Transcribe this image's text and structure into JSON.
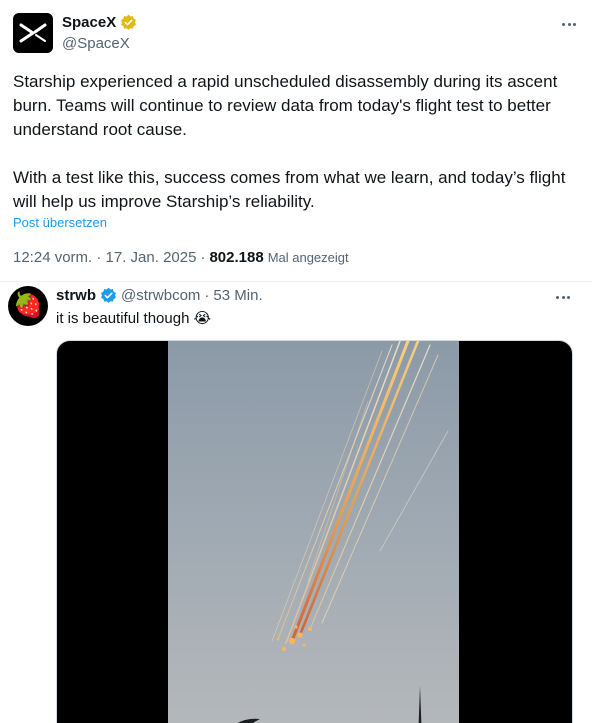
{
  "tweet": {
    "author": {
      "name": "SpaceX",
      "handle": "@SpaceX",
      "verified_badge_color": "#e2b719"
    },
    "paragraphs": [
      "Starship experienced a rapid unscheduled disassembly during its ascent burn. Teams will continue to review data from today's flight test to better understand root cause.",
      "With a test like this, success comes from what we learn, and today’s flight will help us improve Starship’s reliability."
    ],
    "translate_label": "Post übersetzen",
    "timestamp": "12:24 vorm. · 17. Jan. 2025",
    "separator": "·",
    "views_count": "802.188",
    "views_label": "Mal angezeigt",
    "more_icon": "more-horizontal-icon"
  },
  "reply": {
    "author": {
      "name": "strwb",
      "handle": "@strwbcom",
      "verified_badge_color": "#1d9bf0"
    },
    "separator": "·",
    "time": "53 Min.",
    "text": "it is beautiful though",
    "emoji": "😭",
    "avatar_emoji": "🍓",
    "more_icon": "more-horizontal-icon",
    "media_icon": "video-thumbnail"
  },
  "colors": {
    "link": "#1d9bf0",
    "secondary_text": "#536471",
    "primary_text": "#0f1419",
    "divider": "#eff3f4"
  }
}
